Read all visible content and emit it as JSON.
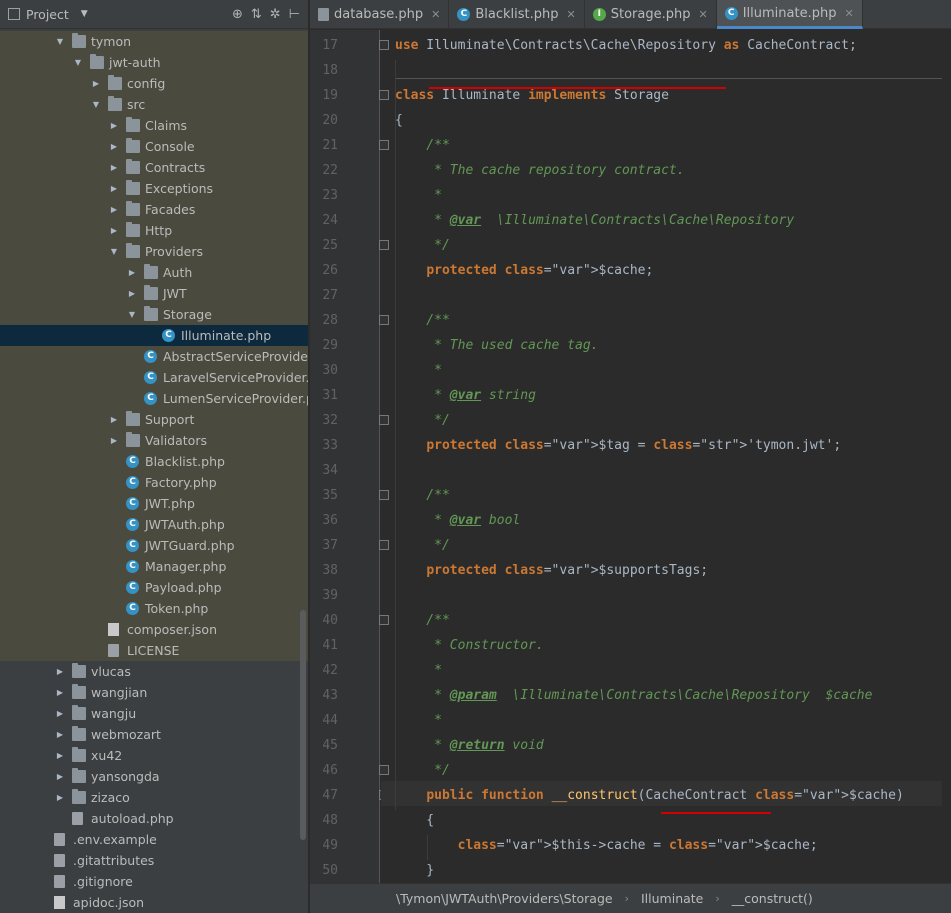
{
  "project_panel": {
    "title": "Project",
    "tree": [
      {
        "label": "tymon",
        "type": "folder",
        "depth": 2,
        "expanded": true,
        "hl": true
      },
      {
        "label": "jwt-auth",
        "type": "folder",
        "depth": 3,
        "expanded": true,
        "hl": true
      },
      {
        "label": "config",
        "type": "folder",
        "depth": 4,
        "expanded": false,
        "hl": true
      },
      {
        "label": "src",
        "type": "folder",
        "depth": 4,
        "expanded": true,
        "hl": true
      },
      {
        "label": "Claims",
        "type": "folder",
        "depth": 5,
        "expanded": false,
        "hl": true
      },
      {
        "label": "Console",
        "type": "folder",
        "depth": 5,
        "expanded": false,
        "hl": true
      },
      {
        "label": "Contracts",
        "type": "folder",
        "depth": 5,
        "expanded": false,
        "hl": true
      },
      {
        "label": "Exceptions",
        "type": "folder",
        "depth": 5,
        "expanded": false,
        "hl": true
      },
      {
        "label": "Facades",
        "type": "folder",
        "depth": 5,
        "expanded": false,
        "hl": true
      },
      {
        "label": "Http",
        "type": "folder",
        "depth": 5,
        "expanded": false,
        "hl": true
      },
      {
        "label": "Providers",
        "type": "folder",
        "depth": 5,
        "expanded": true,
        "hl": true
      },
      {
        "label": "Auth",
        "type": "folder",
        "depth": 6,
        "expanded": false,
        "hl": true
      },
      {
        "label": "JWT",
        "type": "folder",
        "depth": 6,
        "expanded": false,
        "hl": true
      },
      {
        "label": "Storage",
        "type": "folder",
        "depth": 6,
        "expanded": true,
        "hl": true
      },
      {
        "label": "Illuminate.php",
        "type": "class",
        "depth": 7,
        "sel": true
      },
      {
        "label": "AbstractServiceProvider.php",
        "type": "class",
        "depth": 6,
        "hl": true
      },
      {
        "label": "LaravelServiceProvider.php",
        "type": "class",
        "depth": 6,
        "hl": true
      },
      {
        "label": "LumenServiceProvider.php",
        "type": "class",
        "depth": 6,
        "hl": true
      },
      {
        "label": "Support",
        "type": "folder",
        "depth": 5,
        "expanded": false,
        "hl": true
      },
      {
        "label": "Validators",
        "type": "folder",
        "depth": 5,
        "expanded": false,
        "hl": true
      },
      {
        "label": "Blacklist.php",
        "type": "class",
        "depth": 5,
        "hl": true
      },
      {
        "label": "Factory.php",
        "type": "class",
        "depth": 5,
        "hl": true
      },
      {
        "label": "JWT.php",
        "type": "class",
        "depth": 5,
        "hl": true
      },
      {
        "label": "JWTAuth.php",
        "type": "class",
        "depth": 5,
        "hl": true
      },
      {
        "label": "JWTGuard.php",
        "type": "class",
        "depth": 5,
        "hl": true
      },
      {
        "label": "Manager.php",
        "type": "class",
        "depth": 5,
        "hl": true
      },
      {
        "label": "Payload.php",
        "type": "class",
        "depth": 5,
        "hl": true
      },
      {
        "label": "Token.php",
        "type": "class",
        "depth": 5,
        "hl": true
      },
      {
        "label": "composer.json",
        "type": "json",
        "depth": 4,
        "hl": true
      },
      {
        "label": "LICENSE",
        "type": "file",
        "depth": 4,
        "hl": true
      },
      {
        "label": "vlucas",
        "type": "folder",
        "depth": 2,
        "expanded": false
      },
      {
        "label": "wangjian",
        "type": "folder",
        "depth": 2,
        "expanded": false
      },
      {
        "label": "wangju",
        "type": "folder",
        "depth": 2,
        "expanded": false
      },
      {
        "label": "webmozart",
        "type": "folder",
        "depth": 2,
        "expanded": false
      },
      {
        "label": "xu42",
        "type": "folder",
        "depth": 2,
        "expanded": false
      },
      {
        "label": "yansongda",
        "type": "folder",
        "depth": 2,
        "expanded": false
      },
      {
        "label": "zizaco",
        "type": "folder",
        "depth": 2,
        "expanded": false
      },
      {
        "label": "autoload.php",
        "type": "php",
        "depth": 2
      },
      {
        "label": ".env.example",
        "type": "file",
        "depth": 1
      },
      {
        "label": ".gitattributes",
        "type": "file",
        "depth": 1
      },
      {
        "label": ".gitignore",
        "type": "file",
        "depth": 1
      },
      {
        "label": "apidoc.json",
        "type": "json",
        "depth": 1
      }
    ]
  },
  "tabs": [
    {
      "label": "database.php",
      "icon": "php-file-icon",
      "color": "#8c949b",
      "active": false
    },
    {
      "label": "Blacklist.php",
      "icon": "class-icon",
      "color": "#3592c4",
      "active": false
    },
    {
      "label": "Storage.php",
      "icon": "interface-icon",
      "color": "#55a84a",
      "active": false
    },
    {
      "label": "Illuminate.php",
      "icon": "class-icon",
      "color": "#3592c4",
      "active": true
    }
  ],
  "editor": {
    "line_numbers": [
      "17",
      "18",
      "19",
      "20",
      "21",
      "22",
      "23",
      "24",
      "25",
      "26",
      "27",
      "28",
      "29",
      "30",
      "31",
      "32",
      "33",
      "34",
      "35",
      "36",
      "37",
      "38",
      "39",
      "40",
      "41",
      "42",
      "43",
      "44",
      "45",
      "46",
      "47",
      "48",
      "49",
      "50"
    ],
    "lines": [
      "use Illuminate\\Contracts\\Cache\\Repository as CacheContract;",
      "",
      "class Illuminate implements Storage",
      "{",
      "    /**",
      "     * The cache repository contract.",
      "     *",
      "     * @var  \\Illuminate\\Contracts\\Cache\\Repository",
      "     */",
      "    protected $cache;",
      "",
      "    /**",
      "     * The used cache tag.",
      "     *",
      "     * @var string",
      "     */",
      "    protected $tag = 'tymon.jwt';",
      "",
      "    /**",
      "     * @var bool",
      "     */",
      "    protected $supportsTags;",
      "",
      "    /**",
      "     * Constructor.",
      "     *",
      "     * @param  \\Illuminate\\Contracts\\Cache\\Repository  $cache",
      "     *",
      "     * @return void",
      "     */",
      "    public function __construct(CacheContract $cache)",
      "    {",
      "        $this->cache = $cache;",
      "    }"
    ]
  },
  "breadcrumb": [
    "\\Tymon\\JWTAuth\\Providers\\Storage",
    "Illuminate",
    "__construct()"
  ]
}
